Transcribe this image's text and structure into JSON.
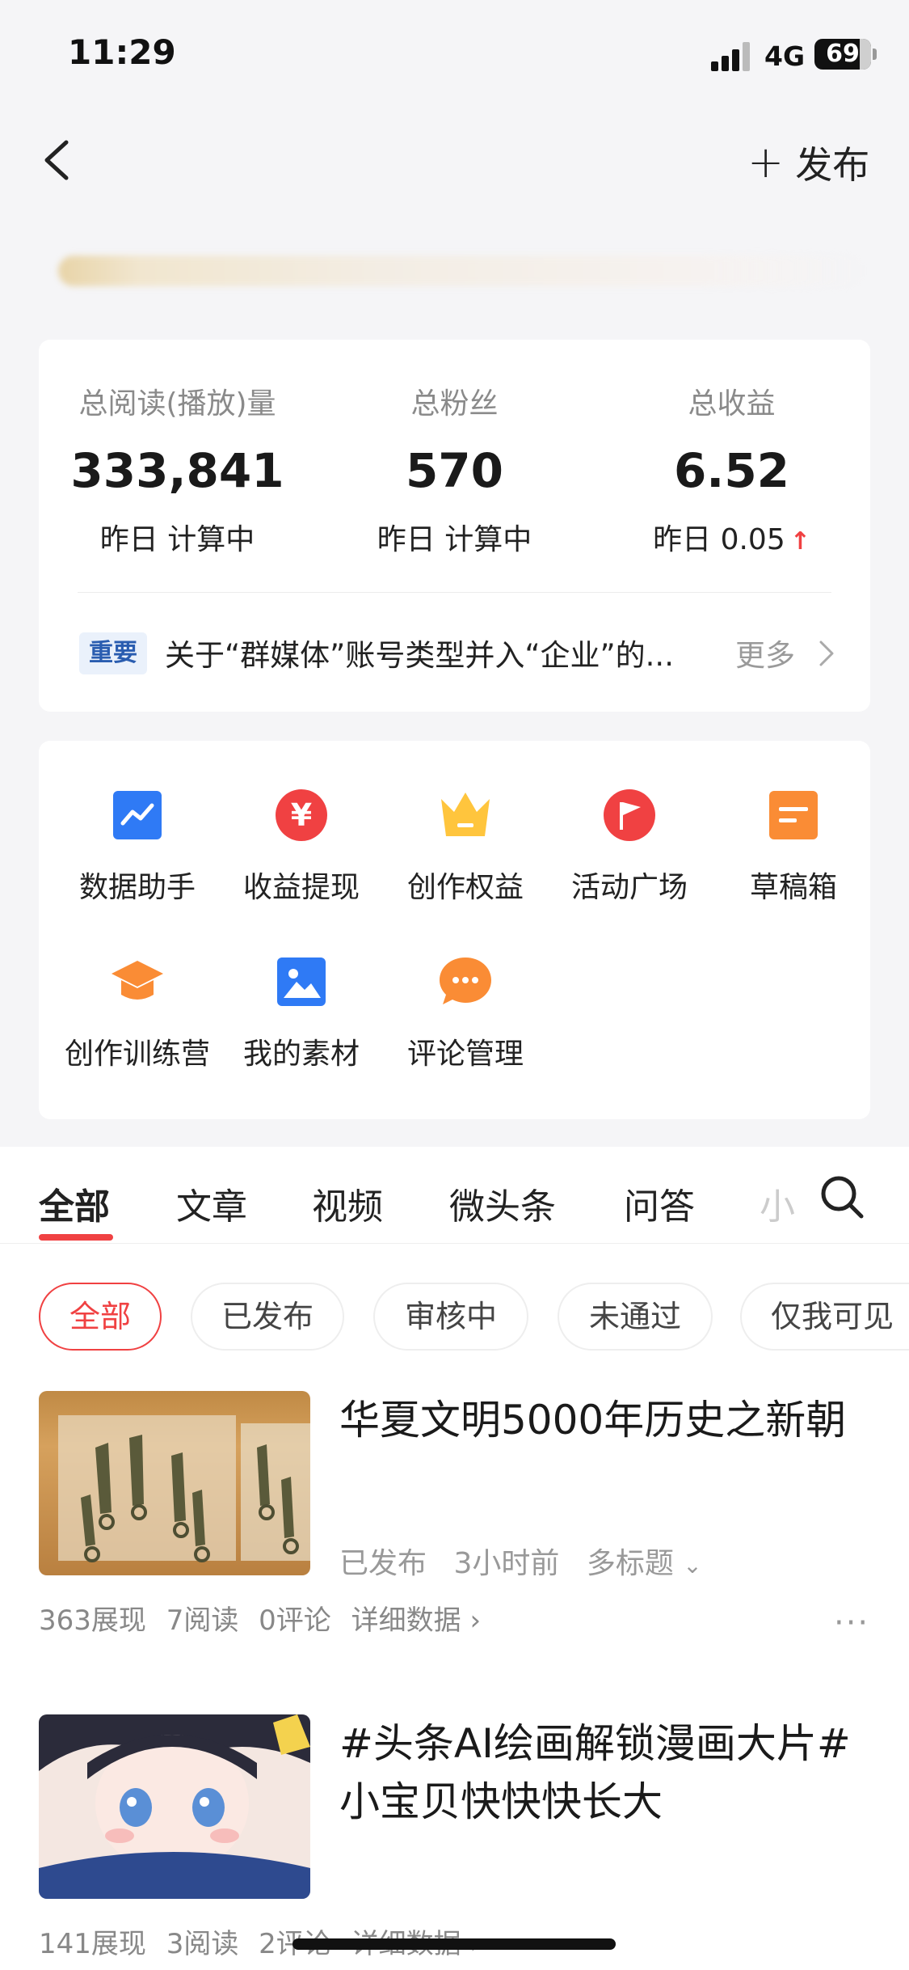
{
  "status": {
    "time": "11:29",
    "network": "4G",
    "battery": "69"
  },
  "nav": {
    "publish_label": "发布"
  },
  "stats": [
    {
      "label": "总阅读(播放)量",
      "value": "333,841",
      "sub": "昨日 计算中"
    },
    {
      "label": "总粉丝",
      "value": "570",
      "sub": "昨日 计算中"
    },
    {
      "label": "总收益",
      "value": "6.52",
      "sub": "昨日 0.05",
      "trend": "↑"
    }
  ],
  "notice": {
    "tag": "重要",
    "text": "关于“群媒体”账号类型并入“企业”的...",
    "more": "更多"
  },
  "tools": [
    {
      "label": "数据助手",
      "icon": "chart-icon",
      "color": "#2f7af5"
    },
    {
      "label": "收益提现",
      "icon": "yuan-icon",
      "color": "#f04142"
    },
    {
      "label": "创作权益",
      "icon": "crown-icon",
      "color": "#ffc53d"
    },
    {
      "label": "活动广场",
      "icon": "flag-icon",
      "color": "#f04142"
    },
    {
      "label": "草稿箱",
      "icon": "draft-icon",
      "color": "#fa8c35"
    },
    {
      "label": "创作训练营",
      "icon": "graduation-cap-icon",
      "color": "#fa8c35"
    },
    {
      "label": "我的素材",
      "icon": "image-icon",
      "color": "#2f7af5"
    },
    {
      "label": "评论管理",
      "icon": "comment-icon",
      "color": "#fa8c35"
    }
  ],
  "tabs": [
    "全部",
    "文章",
    "视频",
    "微头条",
    "问答"
  ],
  "tab_more": "小",
  "chips": [
    "全部",
    "已发布",
    "审核中",
    "未通过",
    "仅我可见"
  ],
  "articles": [
    {
      "title": "华夏文明5000年历史之新朝",
      "status": "已发布",
      "time": "3小时前",
      "multi_title": "多标题",
      "stats": {
        "views": "363展现",
        "reads": "7阅读",
        "comments": "0评论",
        "detail": "详细数据"
      }
    },
    {
      "title_line1": "#头条AI绘画解锁漫画大片#",
      "title_line2": "小宝贝快快快长大",
      "stats": {
        "views": "141展现",
        "reads": "3阅读",
        "comments": "2评论",
        "detail": "详细数据"
      }
    }
  ],
  "colors": {
    "accent": "#f04142",
    "tag_blue": "#2a5db0"
  }
}
